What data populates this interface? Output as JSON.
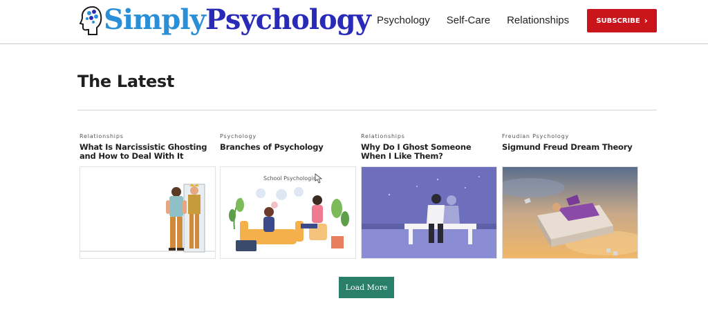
{
  "header": {
    "logo_part1": "Simply",
    "logo_part2": "Psychology",
    "nav": [
      "Psychology",
      "Self-Care",
      "Relationships"
    ],
    "subscribe_label": "SUBSCRIBE"
  },
  "section": {
    "title": "The Latest"
  },
  "cards": [
    {
      "category": "Relationships",
      "title": "What Is Narcissistic Ghosting and How to Deal With It",
      "image": "man-looking-in-mirror-illustration"
    },
    {
      "category": "Psychology",
      "title": "Branches of Psychology",
      "image": "school-psychologist-illustration",
      "image_caption": "School Psychologist"
    },
    {
      "category": "Relationships",
      "title": "Why Do I Ghost Someone When I Like Them?",
      "image": "couple-on-bench-at-night-illustration"
    },
    {
      "category": "Freudian Psychology",
      "title": "Sigmund Freud Dream Theory",
      "image": "woman-sleeping-on-floating-bed-photo"
    }
  ],
  "load_more_label": "Load More",
  "colors": {
    "subscribe_bg": "#c8141a",
    "load_more_bg": "#2a7f6a",
    "logo_blue_light": "#2a8fd6",
    "logo_blue_dark": "#2a2ab8"
  }
}
